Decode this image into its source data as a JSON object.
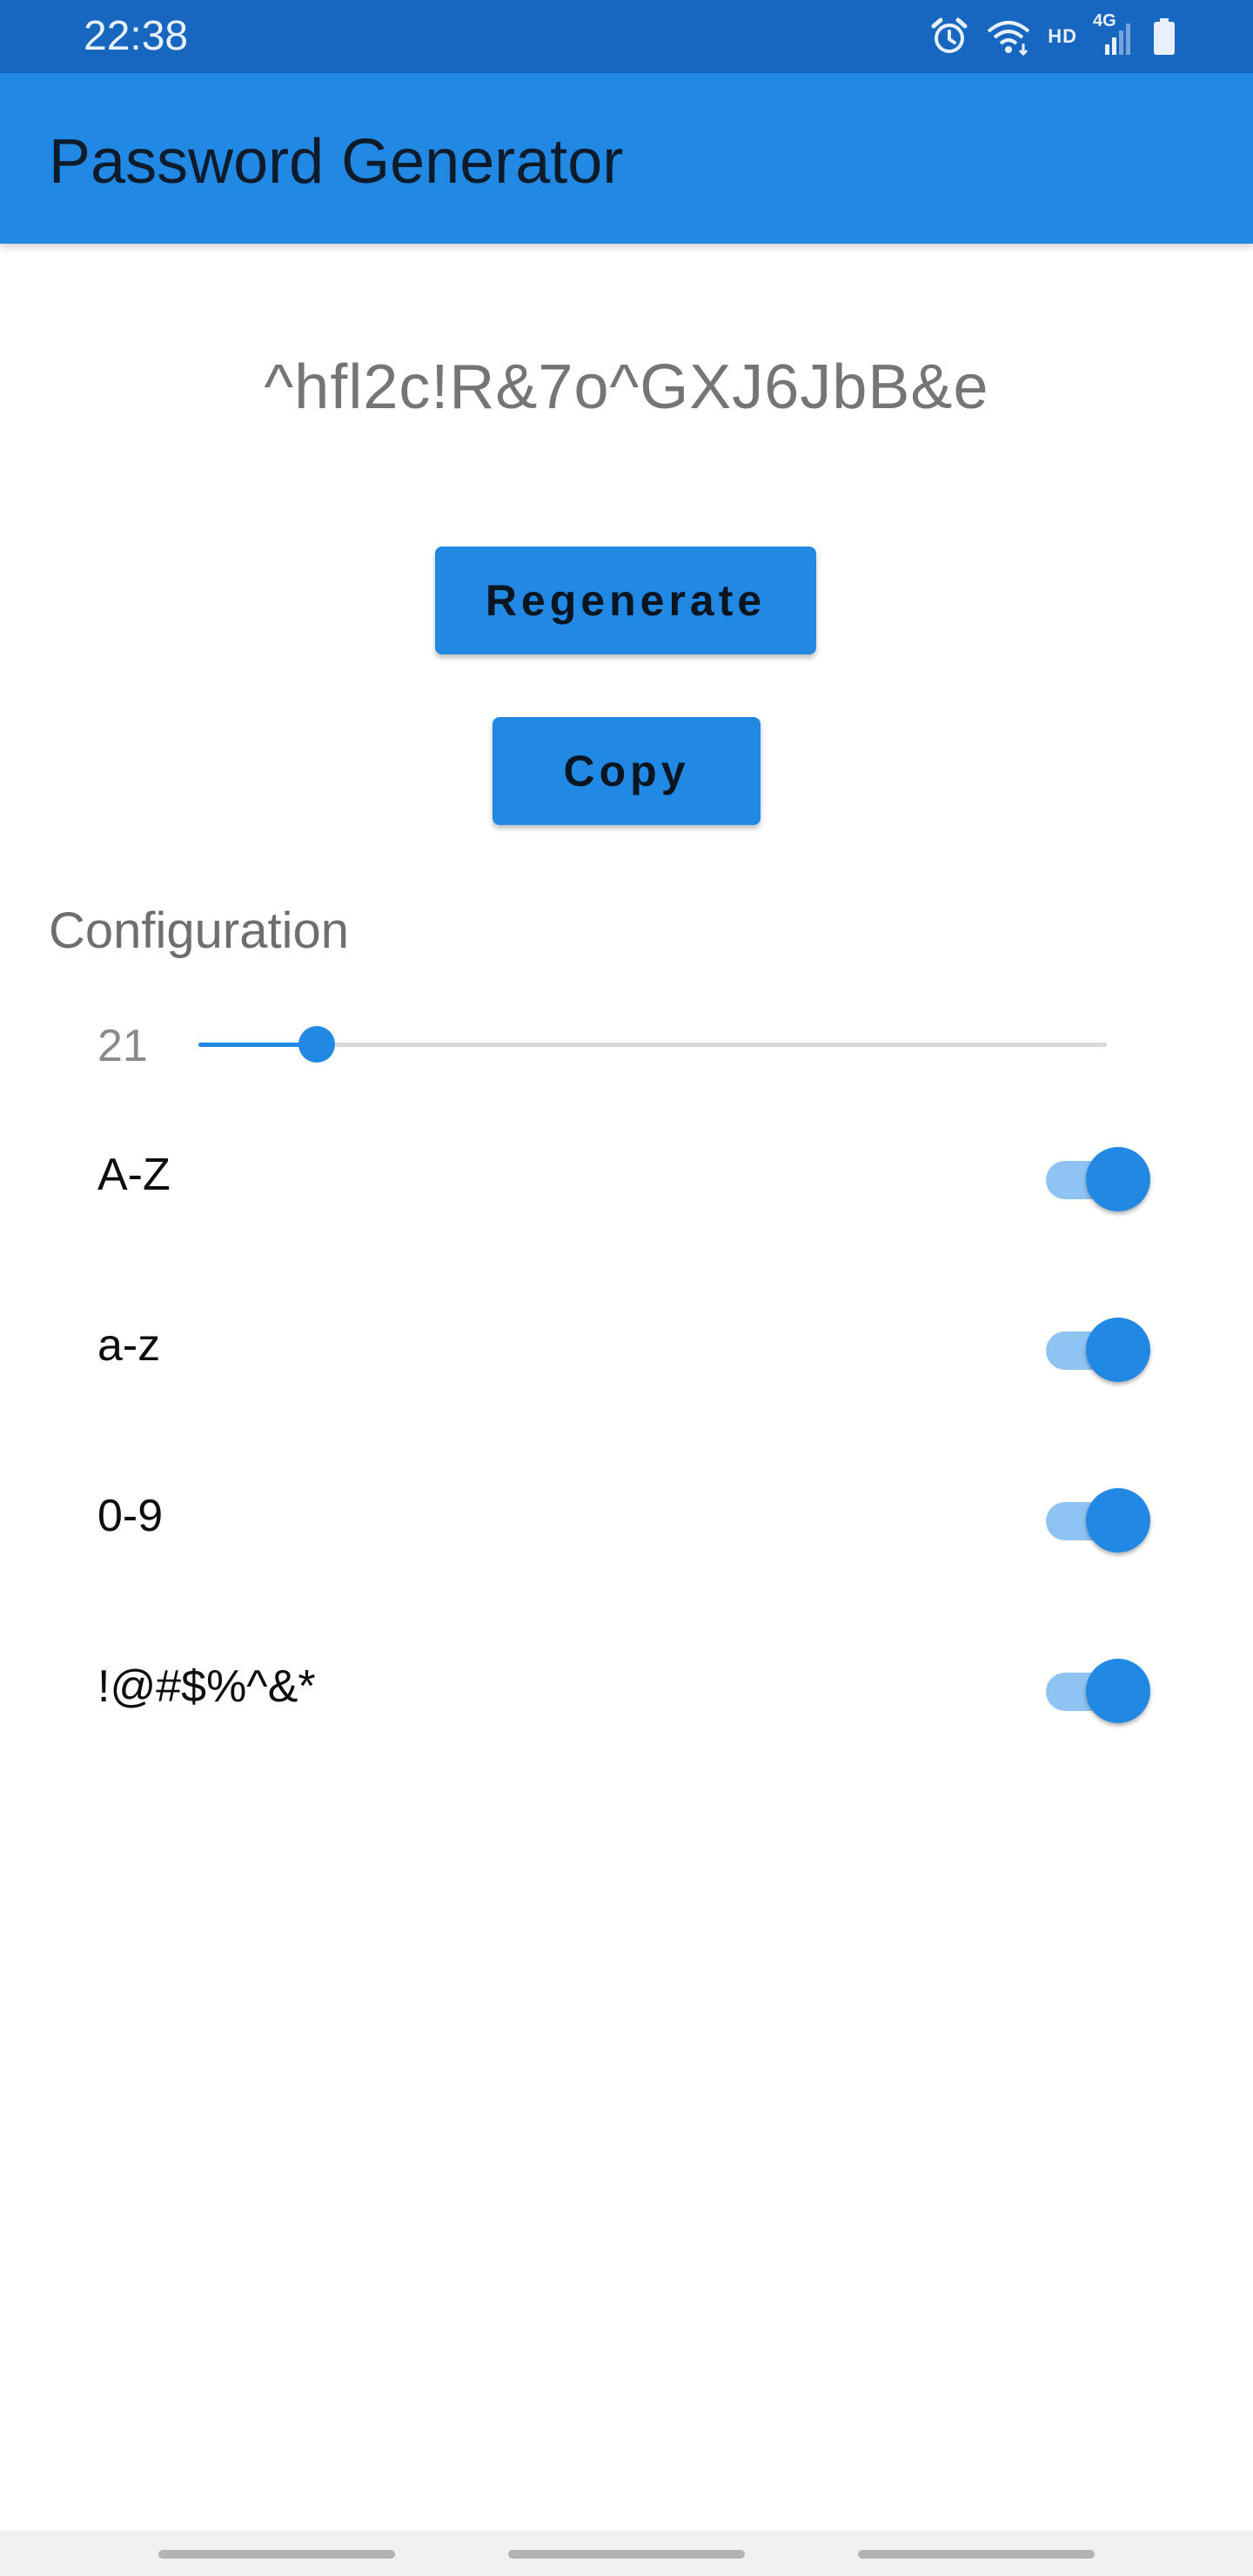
{
  "status_bar": {
    "time": "22:38",
    "icons": [
      "alarm-icon",
      "wifi-icon",
      "hd-icon",
      "signal-4g-icon",
      "battery-icon"
    ],
    "hd_label": "HD",
    "network_label": "4G"
  },
  "app_bar": {
    "title": "Password Generator",
    "color": "#2189e4"
  },
  "password": "^hfl2c!R&7o^GXJ6JbB&e",
  "buttons": {
    "regenerate": "Regenerate",
    "copy": "Copy"
  },
  "configuration": {
    "heading": "Configuration",
    "length_value": "21",
    "length_slider_fraction": 0.13,
    "options": [
      {
        "label": "A-Z",
        "enabled": true
      },
      {
        "label": "a-z",
        "enabled": true
      },
      {
        "label": "0-9",
        "enabled": true
      },
      {
        "label": "!@#$%^&*",
        "enabled": true
      }
    ]
  },
  "colors": {
    "accent": "#2189e4",
    "status_bar": "#1767c1",
    "switch_track": "#8ec3f2"
  }
}
